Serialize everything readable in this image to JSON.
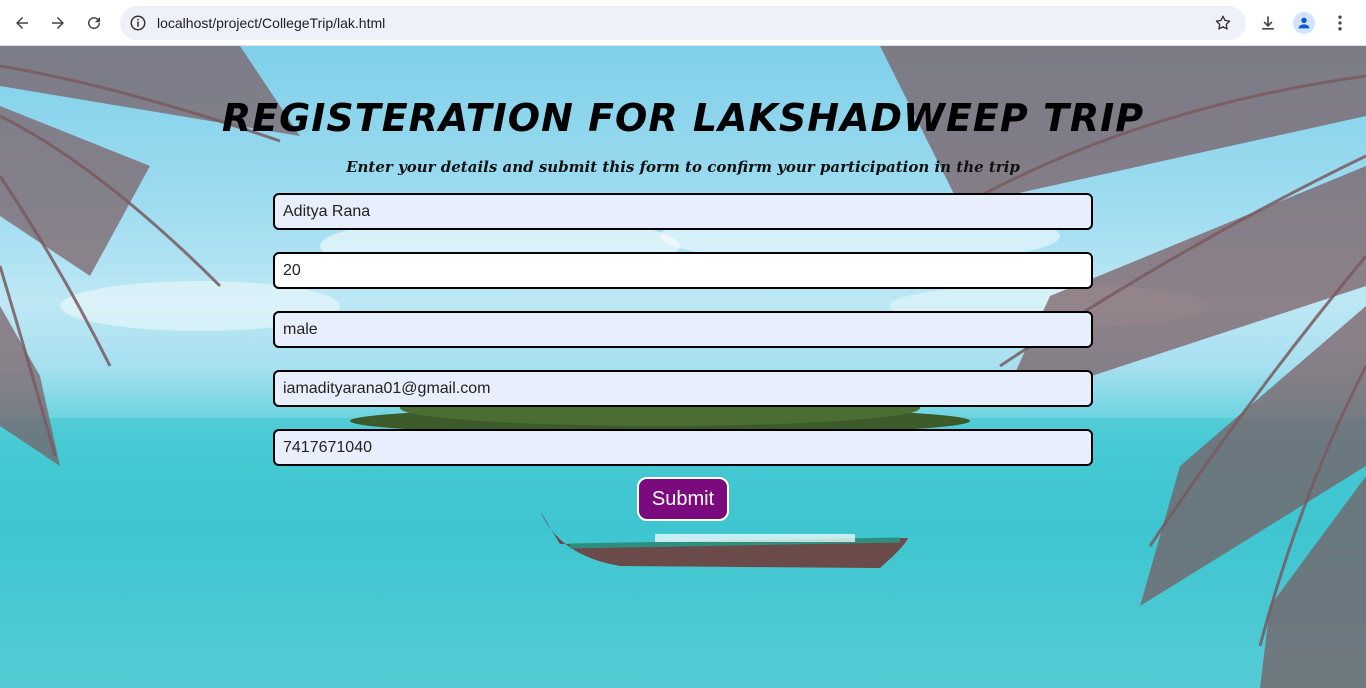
{
  "browser": {
    "url": "localhost/project/CollegeTrip/lak.html",
    "icons": [
      "back-arrow-icon",
      "forward-arrow-icon",
      "reload-icon",
      "info-icon",
      "star-icon",
      "download-icon",
      "profile-icon",
      "kebab-menu-icon"
    ]
  },
  "page": {
    "title": "REGISTERATION FOR LAKSHADWEEP TRIP",
    "subtitle": "Enter your details and submit this form to confirm your participation in the trip",
    "fields": {
      "name": "Aditya Rana",
      "age": "20",
      "gender": "male",
      "email": "iamadityarana01@gmail.com",
      "phone": "7417671040"
    },
    "submit_label": "Submit"
  },
  "colors": {
    "submit_bg": "#7a0a7e",
    "field_bg": "#e8eefb",
    "field_border": "#000000"
  }
}
